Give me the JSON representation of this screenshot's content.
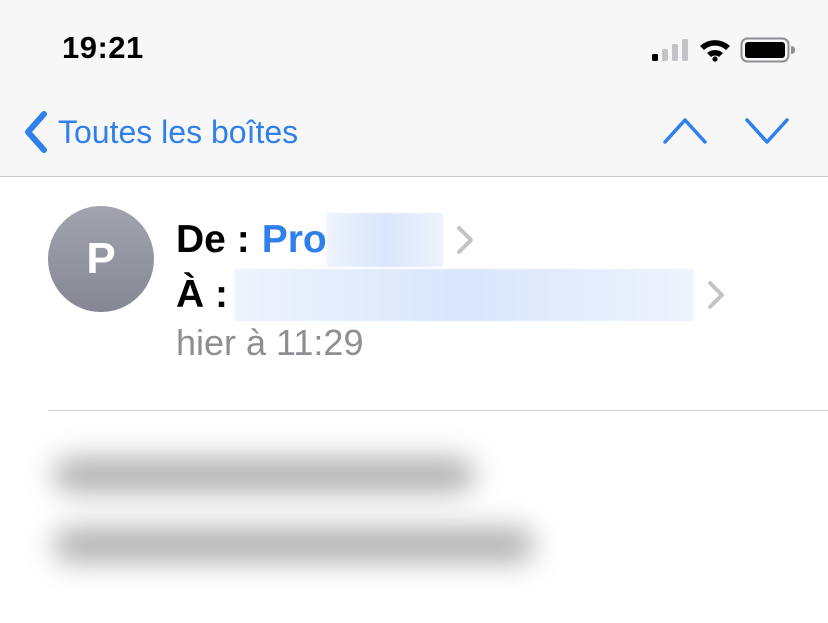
{
  "status_bar": {
    "time": "19:21",
    "signal_icon": "cellular-signal-icon",
    "wifi_icon": "wifi-icon",
    "battery_icon": "battery-icon"
  },
  "nav_bar": {
    "back_label": "Toutes les boîtes",
    "back_icon": "chevron-left-icon",
    "prev_icon": "chevron-up-icon",
    "next_icon": "chevron-down-icon",
    "accent_color": "#2f80ed"
  },
  "message": {
    "avatar_initial": "P",
    "from_label": "De :",
    "from_name": "Pro",
    "to_label": "À :",
    "date": "hier à 11:29"
  }
}
